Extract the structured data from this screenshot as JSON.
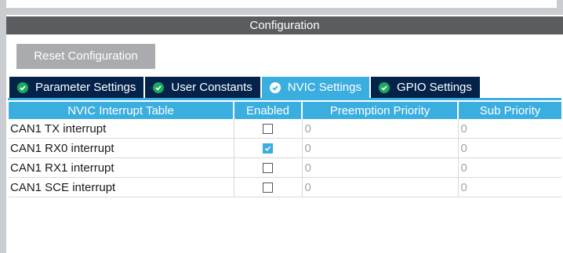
{
  "header": {
    "title": "Configuration"
  },
  "toolbar": {
    "reset_label": "Reset Configuration"
  },
  "tabs": [
    {
      "label": "Parameter Settings",
      "icon": "check-circle-icon",
      "active": false
    },
    {
      "label": "User Constants",
      "icon": "check-circle-icon",
      "active": false
    },
    {
      "label": "NVIC Settings",
      "icon": "check-circle-icon",
      "active": true
    },
    {
      "label": "GPIO Settings",
      "icon": "check-circle-icon",
      "active": false
    }
  ],
  "table": {
    "columns": [
      "NVIC Interrupt Table",
      "Enabled",
      "Preemption Priority",
      "Sub Priority"
    ],
    "rows": [
      {
        "name": "CAN1 TX interrupt",
        "enabled": false,
        "preemption": "0",
        "sub": "0"
      },
      {
        "name": "CAN1 RX0 interrupt",
        "enabled": true,
        "preemption": "0",
        "sub": "0"
      },
      {
        "name": "CAN1 RX1 interrupt",
        "enabled": false,
        "preemption": "0",
        "sub": "0"
      },
      {
        "name": "CAN1 SCE interrupt",
        "enabled": false,
        "preemption": "0",
        "sub": "0"
      }
    ]
  },
  "colors": {
    "accent": "#3baee0",
    "tab_dark": "#03234b",
    "header": "#5a5c60",
    "check_green": "#1aaa5f"
  }
}
